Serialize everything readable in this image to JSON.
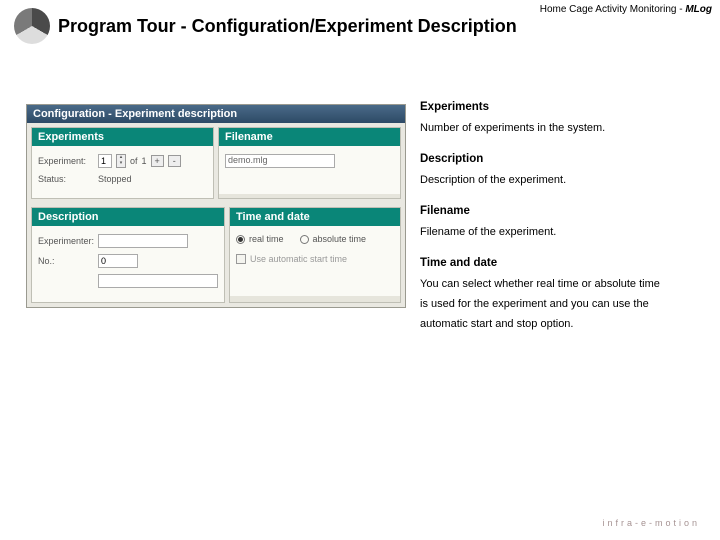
{
  "header": {
    "product_line": "Home Cage Activity Monitoring - ",
    "product_short": "MLog"
  },
  "page_title": "Program Tour - Configuration/Experiment Description",
  "window": {
    "title": "Configuration - Experiment description",
    "panels": {
      "experiments": {
        "header": "Experiments",
        "label_experiment": "Experiment:",
        "val_num": "1",
        "txt_of": "of",
        "val_total": "1",
        "btn_plus": "+",
        "btn_minus": "-",
        "label_status": "Status:",
        "val_status": "Stopped"
      },
      "filename": {
        "header": "Filename",
        "value": "demo.mlg"
      },
      "description": {
        "header": "Description",
        "label_experimenter": "Experimenter:",
        "label_no": "No.:",
        "val_no": "0"
      },
      "time_date": {
        "header": "Time and date",
        "radio_real": "real time",
        "radio_abs": "absolute time",
        "chk_autostart": "Use automatic start time"
      }
    }
  },
  "doc": {
    "h_exp": "Experiments",
    "p_exp": "Number of experiments in the system.",
    "h_desc": "Description",
    "p_desc": "Description of the experiment.",
    "h_file": "Filename",
    "p_file": "Filename of the experiment.",
    "h_td": "Time and date",
    "p_td1": "You can select whether real time or absolute time",
    "p_td2": "is used for the experiment and you can use the",
    "p_td3": "automatic start and stop option."
  },
  "footer": "infra-e-motion"
}
